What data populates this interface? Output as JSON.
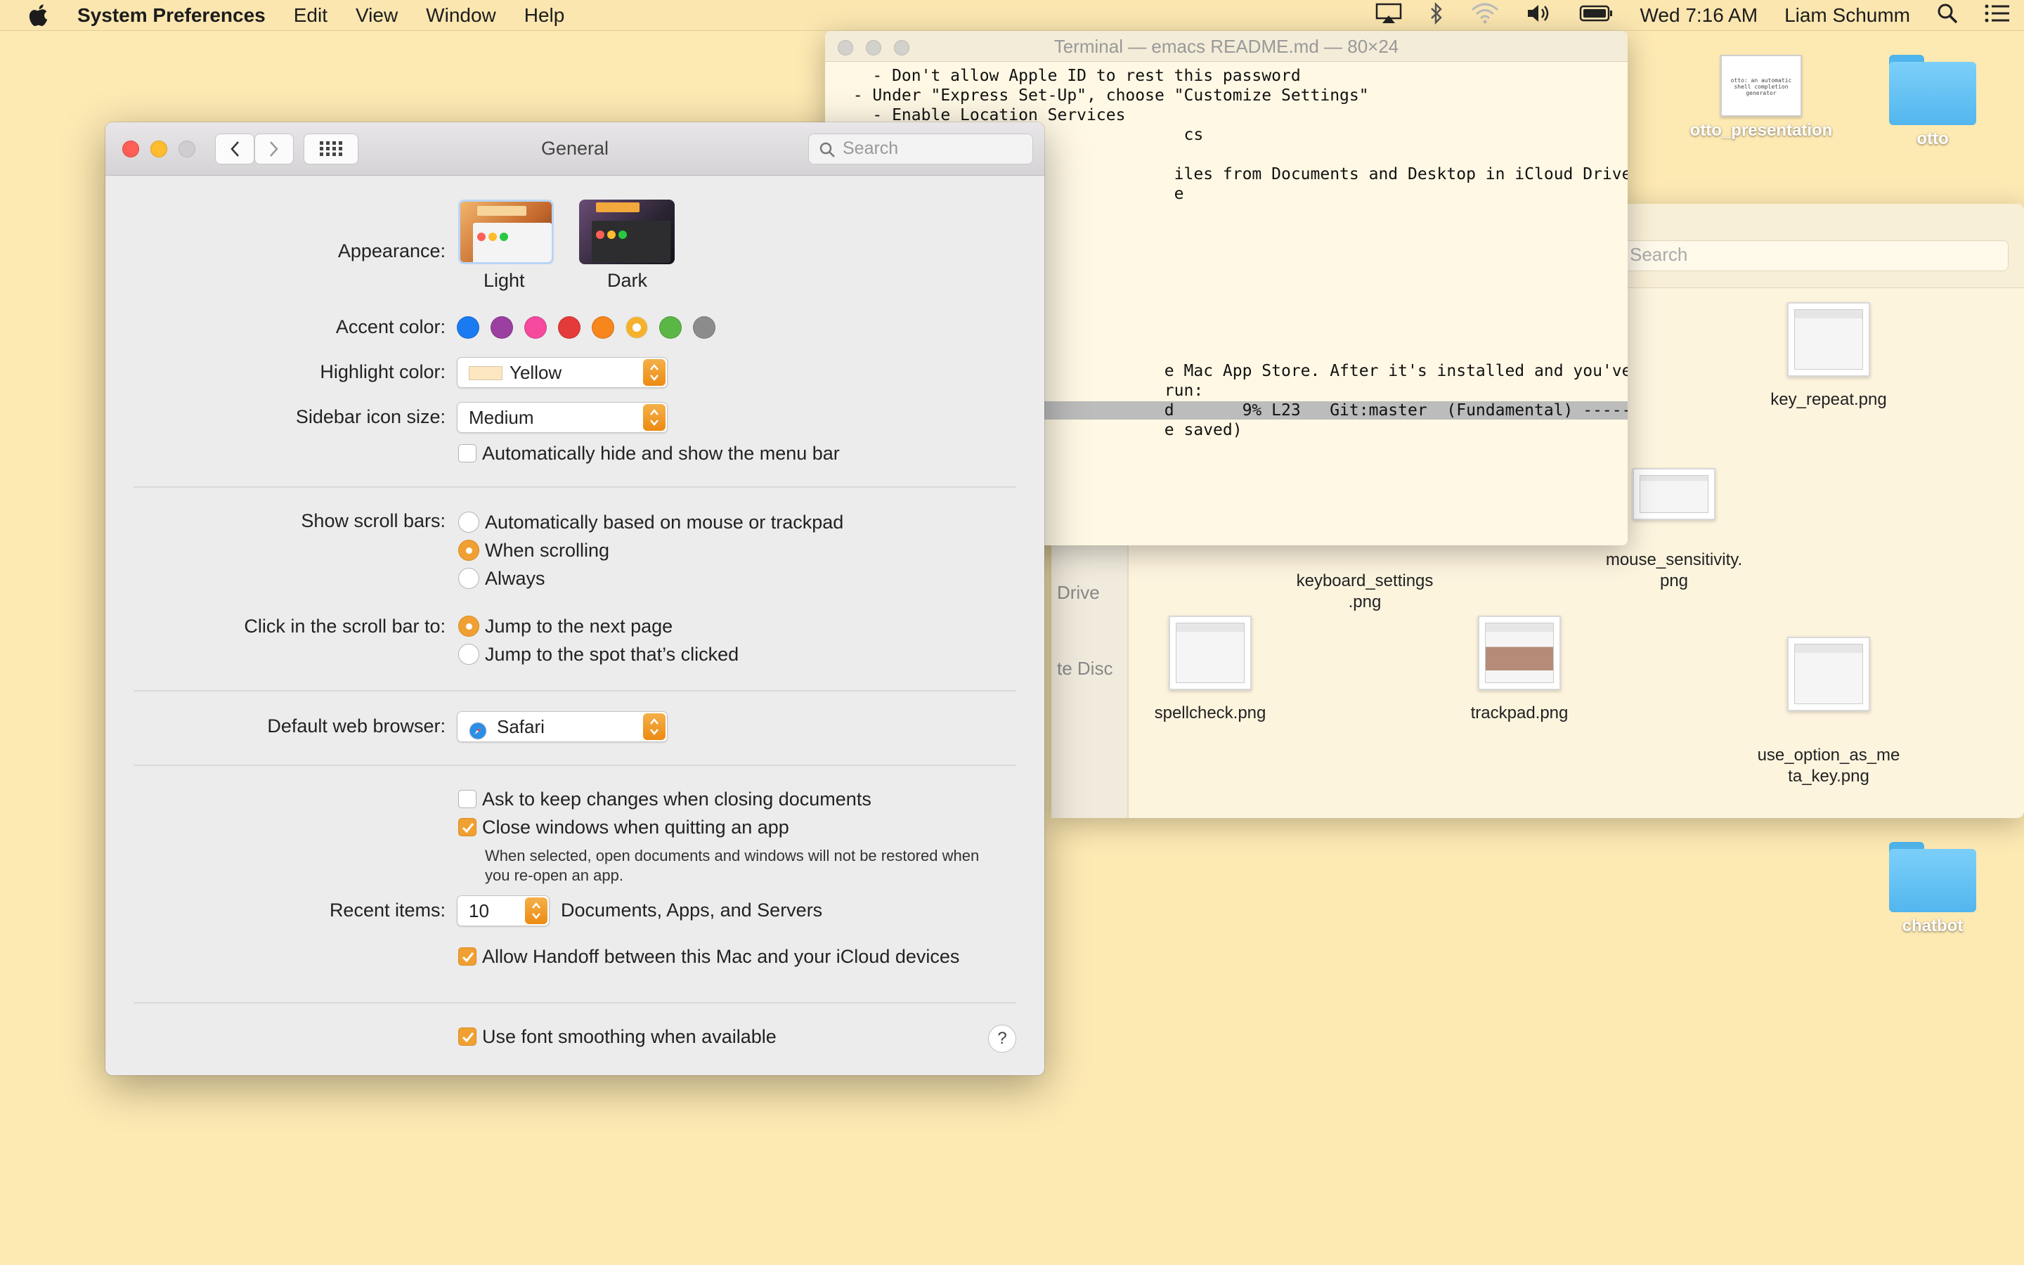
{
  "menubar": {
    "app_name": "System Preferences",
    "menus": [
      "Edit",
      "View",
      "Window",
      "Help"
    ],
    "clock": "Wed 7:16 AM",
    "user": "Liam Schumm"
  },
  "desktop": {
    "items": [
      {
        "label": "otto_presentation",
        "thumb_text": "otto: an automatic shell completion generator"
      },
      {
        "label": "otto"
      },
      {
        "label": "chatbot"
      }
    ]
  },
  "finder": {
    "search_placeholder": "Search",
    "sidebar": [
      "Drive",
      "te Disc"
    ],
    "files": [
      {
        "label": "key_repeat.png"
      },
      {
        "label": "keyboard_settings\n.png"
      },
      {
        "label": "mouse_sensitivity.\npng"
      },
      {
        "label": "spellcheck.png"
      },
      {
        "label": "trackpad.png"
      },
      {
        "label": "use_option_as_me\nta_key.png"
      }
    ]
  },
  "terminal": {
    "title": "Terminal — emacs README.md — 80×24",
    "lines": [
      "    - Don't allow Apple ID to rest this password",
      "  - Under \"Express Set-Up\", choose \"Customize Settings\"",
      "    - Enable Location Services",
      "                                    cs",
      "",
      "                                   iles from Documents and Desktop in iCloud Drive\"",
      "                                   e"
    ],
    "bottom_lines": [
      "                                  e Mac App Store. After it's installed and you've opened it\\",
      "                                  run:"
    ],
    "modeline": "                                  d       9% L23   Git:master  (Fundamental) ----------------",
    "echo": "                                  e saved)"
  },
  "prefs": {
    "title": "General",
    "search_placeholder": "Search",
    "appearance": {
      "label": "Appearance:",
      "options": [
        "Light",
        "Dark"
      ]
    },
    "accent": {
      "label": "Accent color:",
      "colors": [
        "#1a7af2",
        "#9b3fa0",
        "#f54a9d",
        "#e53a3a",
        "#f7861c",
        "#f5b12c",
        "#5ab645",
        "#8c8c8c"
      ],
      "selected": 5
    },
    "highlight": {
      "label": "Highlight color:",
      "value": "Yellow",
      "swatch": "#fde7c0"
    },
    "sidebar_size": {
      "label": "Sidebar icon size:",
      "value": "Medium"
    },
    "autohide_menu": {
      "label": "Automatically hide and show the menu bar",
      "checked": false
    },
    "scroll_bars": {
      "label": "Show scroll bars:",
      "options": [
        "Automatically based on mouse or trackpad",
        "When scrolling",
        "Always"
      ],
      "selected": 1
    },
    "click_scroll": {
      "label": "Click in the scroll bar to:",
      "options": [
        "Jump to the next page",
        "Jump to the spot that’s clicked"
      ],
      "selected": 0
    },
    "browser": {
      "label": "Default web browser:",
      "value": "Safari"
    },
    "ask_keep": {
      "label": "Ask to keep changes when closing documents",
      "checked": false
    },
    "close_windows": {
      "label": "Close windows when quitting an app",
      "checked": true,
      "note": "When selected, open documents and windows will not be restored when you re-open an app."
    },
    "recent": {
      "label": "Recent items:",
      "value": "10",
      "suffix": "Documents, Apps, and Servers"
    },
    "handoff": {
      "label": "Allow Handoff between this Mac and your iCloud devices",
      "checked": true
    },
    "font_smoothing": {
      "label": "Use font smoothing when available",
      "checked": true
    },
    "help": "?"
  },
  "colors": {
    "accent_orange": "#f0a032",
    "desktop": "#fde9b2"
  }
}
